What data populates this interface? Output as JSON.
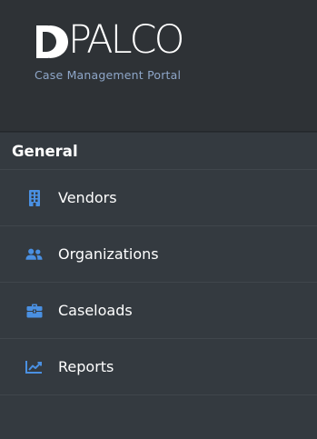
{
  "brand": {
    "logo_word": "PALCO",
    "tagline": "Case Management Portal"
  },
  "colors": {
    "sidebar_bg": "#343a40",
    "brand_bg": "#2e3236",
    "icon_accent": "#4a90e2",
    "tagline": "#8ea6c8",
    "text": "#ffffff"
  },
  "sidebar": {
    "section_title": "General",
    "items": [
      {
        "label": "Vendors",
        "icon": "building-icon"
      },
      {
        "label": "Organizations",
        "icon": "users-icon"
      },
      {
        "label": "Caseloads",
        "icon": "briefcase-icon"
      },
      {
        "label": "Reports",
        "icon": "chart-line-icon"
      }
    ]
  }
}
